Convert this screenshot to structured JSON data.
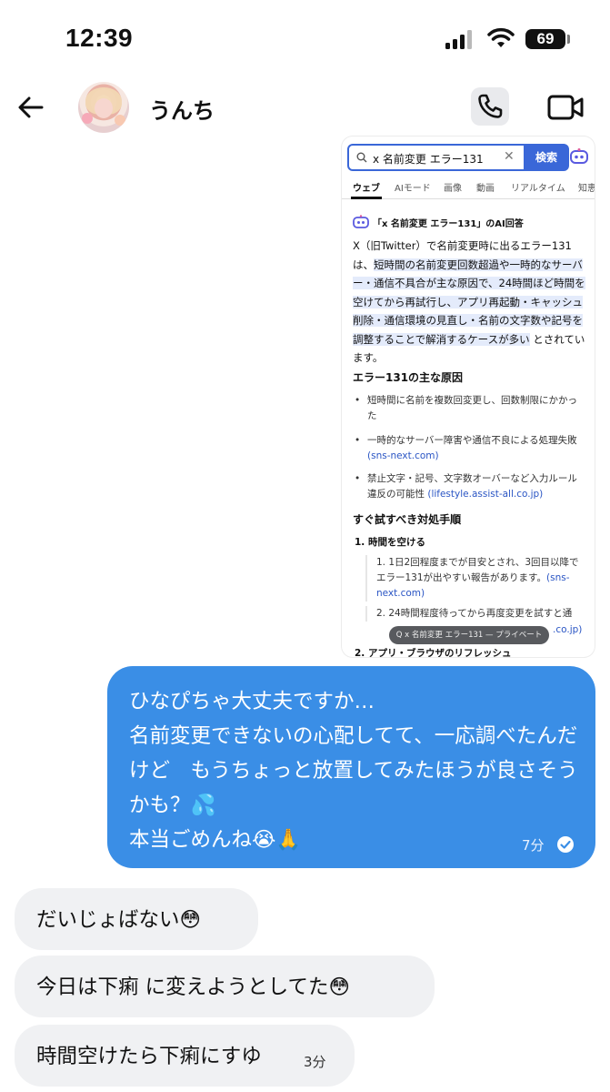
{
  "status_bar": {
    "time": "12:39",
    "battery": "69"
  },
  "header": {
    "name": "うんち",
    "icons": [
      "back-arrow-icon",
      "phone-icon",
      "video-camera-icon"
    ]
  },
  "screenshot": {
    "search_query": "x 名前変更 エラー131",
    "search_button": "検索",
    "tabs": [
      "ウェブ",
      "AIモード",
      "画像",
      "動画",
      "リアルタイム",
      "知恵"
    ],
    "ai_title": "「x 名前変更 エラー131」のAI回答",
    "para_a": "X（旧Twitter）で名前変更時に出るエラー131は、",
    "para_highlight": "短時間の名前変更回数超過や一時的なサーバー・通信不具合が主な原因で、24時間ほど時間を空けてから再試行し、アプリ再起動・キャッシュ削除・通信環境の見直し・名前の文字数や記号を調整することで解消するケースが多い",
    "para_b": "とされています。",
    "heading_causes": "エラー131の主な原因",
    "causes": [
      {
        "text": "短時間に名前を複数回変更し、回数制限にかかった",
        "source": ""
      },
      {
        "text": "一時的なサーバー障害や通信不良による処理失敗",
        "source": "(sns-next.com)"
      },
      {
        "text": "禁止文字・記号、文字数オーバーなど入力ルール違反の可能性",
        "source": "(lifestyle.assist-all.co.jp)"
      }
    ],
    "heading_steps": "すぐ試すべき対処手順",
    "step1": "1. 時間を空ける",
    "sub1_text": "1. 1日2回程度までが目安とされ、3回目以降でエラー131が出やすい報告があります。",
    "sub1_source": "(sns-next.com)",
    "sub2_text": "2. 24時間程度待ってから再度変更を試すと通",
    "sub2_tail": ".co.jp)",
    "private_pill": "Q x 名前変更 エラー131 — プライベート",
    "step2_partial": "2. アプリ・ブラウザのリフレッシュ"
  },
  "messages": {
    "outgoing": {
      "text": "ひなぴちゃ大丈夫ですか…\n名前変更できないの心配してて、一応調べたんだけど　もうちょっと放置してみたほうが良さそうかも？💦\n本当ごめんね😭🙏",
      "time": "7分"
    },
    "incoming": [
      {
        "text": "だいじょばない😳",
        "time": ""
      },
      {
        "text": "今日は下痢  に変えようとしてた😳",
        "time": ""
      },
      {
        "text": "時間空けたら下痢にすゆ",
        "time": "3分"
      }
    ]
  },
  "colors": {
    "outgoing_bubble": "#3a8ee6",
    "incoming_bubble": "#f0f1f3",
    "search_accent": "#3a67d8"
  }
}
